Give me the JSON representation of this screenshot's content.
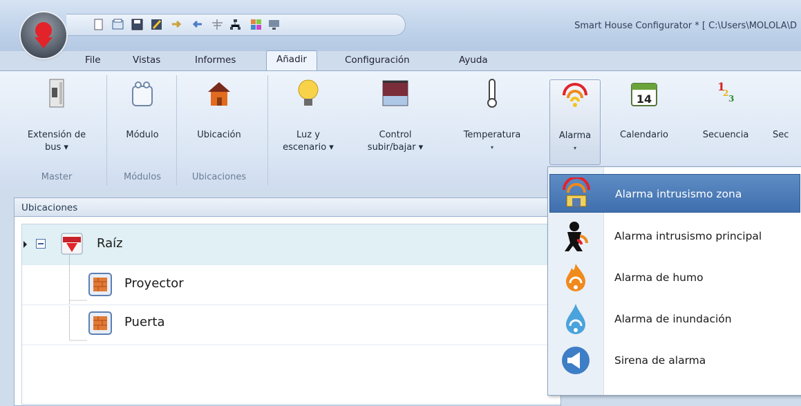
{
  "window": {
    "title": "Smart House Configurator * [ C:\\Users\\MOLOLA\\D"
  },
  "tabs": [
    "File",
    "Vistas",
    "Informes",
    "Añadir",
    "Configuración",
    "Ayuda"
  ],
  "active_tab": "Añadir",
  "ribbon": {
    "buttons": [
      {
        "label1": "Extensión de",
        "label2": "bus ▾",
        "icon": "bus-extension-icon"
      },
      {
        "label1": "Módulo",
        "label2": "",
        "icon": "module-icon"
      },
      {
        "label1": "Ubicación",
        "label2": "",
        "icon": "house-icon"
      },
      {
        "label1": "Luz y",
        "label2": "escenario ▾",
        "icon": "lightbulb-icon"
      },
      {
        "label1": "Control",
        "label2": "subir/bajar ▾",
        "icon": "blind-icon"
      },
      {
        "label1": "Temperatura",
        "label2": "▾",
        "icon": "thermometer-icon"
      },
      {
        "label1": "Alarma",
        "label2": "▾",
        "icon": "alarm-icon"
      },
      {
        "label1": "Calendario",
        "label2": "",
        "icon": "calendar-icon"
      },
      {
        "label1": "Secuencia",
        "label2": "",
        "icon": "sequence-icon"
      },
      {
        "label1": "Sec",
        "label2": "",
        "icon": "partial-icon"
      }
    ],
    "groups": [
      "Master",
      "Módulos",
      "Ubicaciones"
    ],
    "calendar_day": "14",
    "sequence_digits": [
      "1",
      "2",
      "3"
    ]
  },
  "panel": {
    "title": "Ubicaciones",
    "tree": {
      "root": "Raíz",
      "children": [
        "Proyector",
        "Puerta"
      ]
    }
  },
  "menu": {
    "items": [
      {
        "label": "Alarma intrusismo zona",
        "icon": "zone-intrusion-alarm-icon"
      },
      {
        "label": "Alarma intrusismo principal",
        "icon": "main-intrusion-alarm-icon"
      },
      {
        "label": "Alarma de humo",
        "icon": "smoke-alarm-icon"
      },
      {
        "label": "Alarma de inundación",
        "icon": "flood-alarm-icon"
      },
      {
        "label": "Sirena de alarma",
        "icon": "siren-icon"
      }
    ],
    "highlighted_index": 0
  },
  "colors": {
    "accent": "#3f6fae",
    "brand_red": "#e2232a",
    "ribbon_bg": "#dbe6f4"
  }
}
